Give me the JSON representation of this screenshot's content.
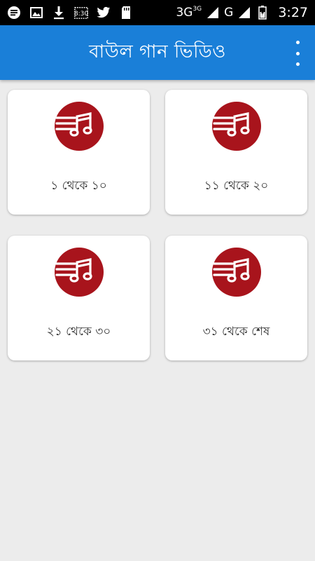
{
  "status_bar": {
    "icons": [
      "message-icon",
      "image-icon",
      "download-icon",
      "calendar-icon",
      "twitter-icon",
      "sd-card-icon"
    ],
    "network_1": "3G",
    "network_1_sup": "3G",
    "network_2": "G",
    "time": "3:27"
  },
  "app_bar": {
    "title": "বাউল গান ভিডিও",
    "menu_icon": "overflow-menu-icon"
  },
  "categories": [
    {
      "label": "১ থেকে ১০",
      "icon": "music-note-icon"
    },
    {
      "label": "১১ থেকে ২০",
      "icon": "music-note-icon"
    },
    {
      "label": "২১ থেকে ৩০",
      "icon": "music-note-icon"
    },
    {
      "label": "৩১ থেকে শেষ",
      "icon": "music-note-icon"
    }
  ],
  "colors": {
    "app_bar": "#1a7fd8",
    "icon_red": "#a8141c",
    "background": "#ececec"
  }
}
